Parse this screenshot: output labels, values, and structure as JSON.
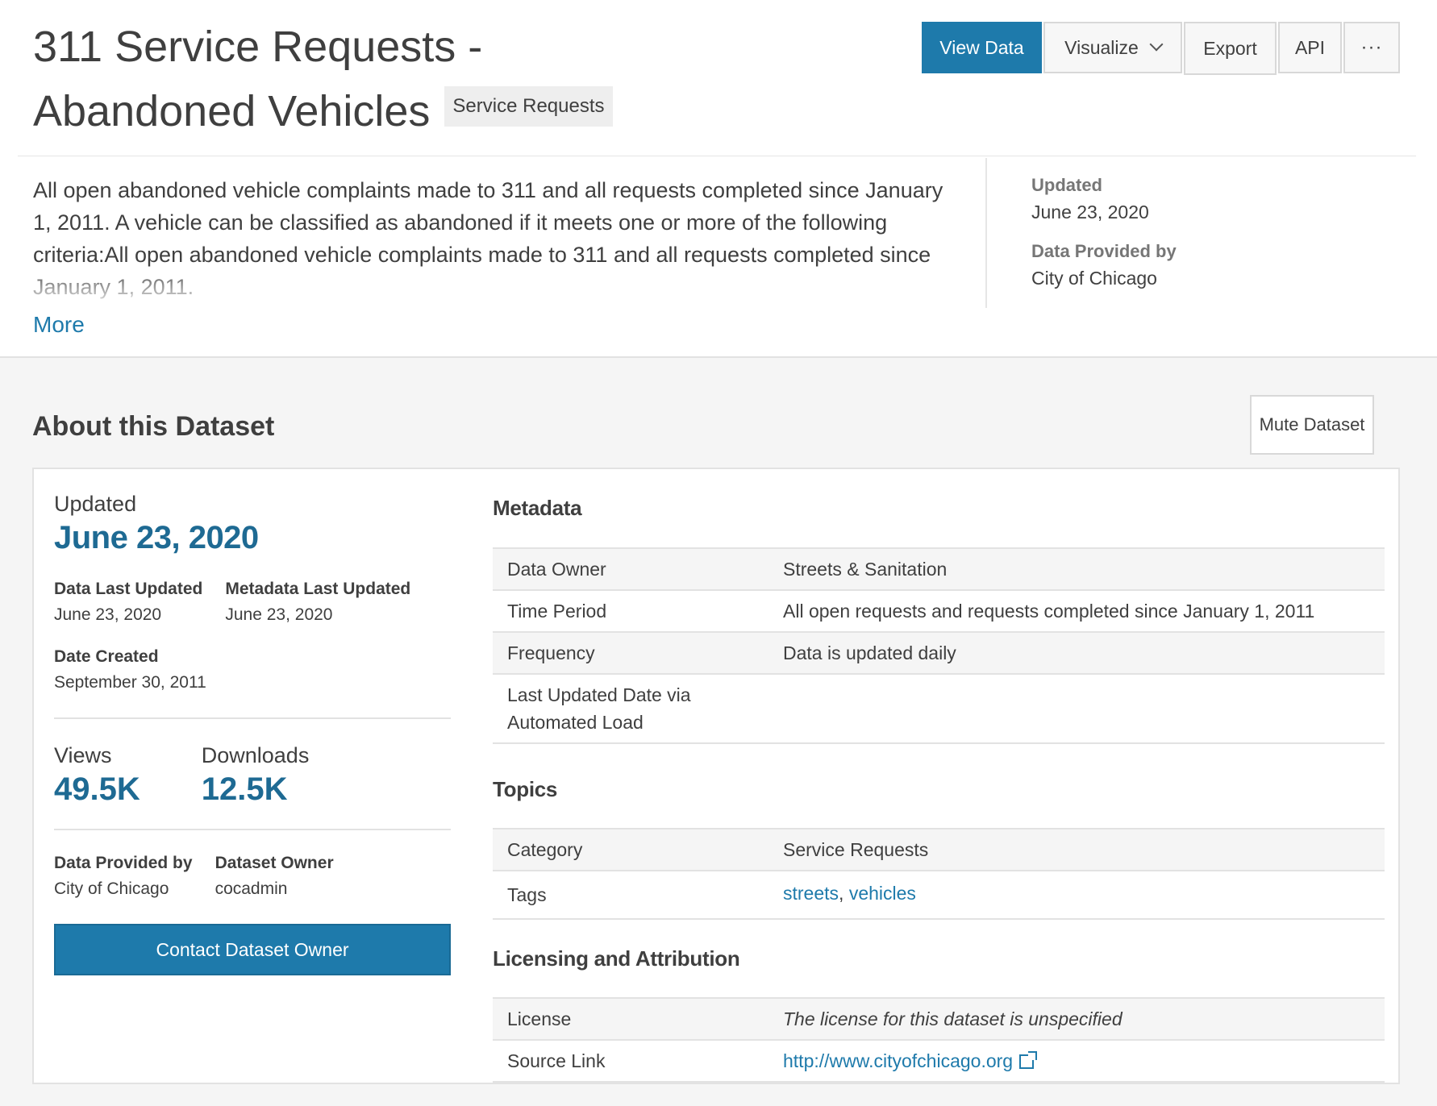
{
  "header": {
    "title": "311 Service Requests - Abandoned Vehicles",
    "category_badge": "Service Requests",
    "actions": {
      "view_data": "View Data",
      "visualize": "Visualize",
      "export": "Export",
      "api": "API",
      "more": "···"
    },
    "description": "All open abandoned vehicle complaints made to 311 and all requests completed since January 1, 2011. A vehicle can be classified as abandoned if it meets one or more of the following criteria:All open abandoned vehicle complaints made to 311 and all requests completed since January 1, 2011.",
    "more_link": "More",
    "side": {
      "updated_label": "Updated",
      "updated_value": "June 23, 2020",
      "provided_label": "Data Provided by",
      "provided_value": "City of Chicago"
    }
  },
  "about": {
    "title": "About this Dataset",
    "mute_button": "Mute Dataset",
    "left": {
      "updated_label": "Updated",
      "updated_value": "June 23, 2020",
      "data_last_updated_label": "Data Last Updated",
      "data_last_updated_value": "June 23, 2020",
      "metadata_last_updated_label": "Metadata Last Updated",
      "metadata_last_updated_value": "June 23, 2020",
      "date_created_label": "Date Created",
      "date_created_value": "September 30, 2011",
      "views_label": "Views",
      "views_value": "49.5K",
      "downloads_label": "Downloads",
      "downloads_value": "12.5K",
      "provided_label": "Data Provided by",
      "provided_value": "City of Chicago",
      "owner_label": "Dataset Owner",
      "owner_value": "cocadmin",
      "contact_button": "Contact Dataset Owner"
    },
    "metadata": {
      "title": "Metadata",
      "rows": [
        {
          "key": "Data Owner",
          "value": "Streets & Sanitation"
        },
        {
          "key": "Time Period",
          "value": "All open requests and requests completed since January 1, 2011"
        },
        {
          "key": "Frequency",
          "value": "Data is updated daily"
        },
        {
          "key": "Last Updated Date via Automated Load",
          "value": ""
        }
      ]
    },
    "topics": {
      "title": "Topics",
      "category_label": "Category",
      "category_value": "Service Requests",
      "tags_label": "Tags",
      "tags": [
        "streets",
        "vehicles"
      ],
      "tag_separator": ", "
    },
    "licensing": {
      "title": "Licensing and Attribution",
      "license_label": "License",
      "license_value": "The license for this dataset is unspecified",
      "source_label": "Source Link",
      "source_value": "http://www.cityofchicago.org"
    }
  },
  "colors": {
    "accent": "#1e7aab",
    "accent_dark": "#1e6a93",
    "text": "#3f3f3f",
    "muted": "#767676",
    "panel_bg": "#f5f5f5"
  },
  "icons": {
    "visualize_dropdown": "chevron-down-icon",
    "source_link": "external-link-icon"
  }
}
